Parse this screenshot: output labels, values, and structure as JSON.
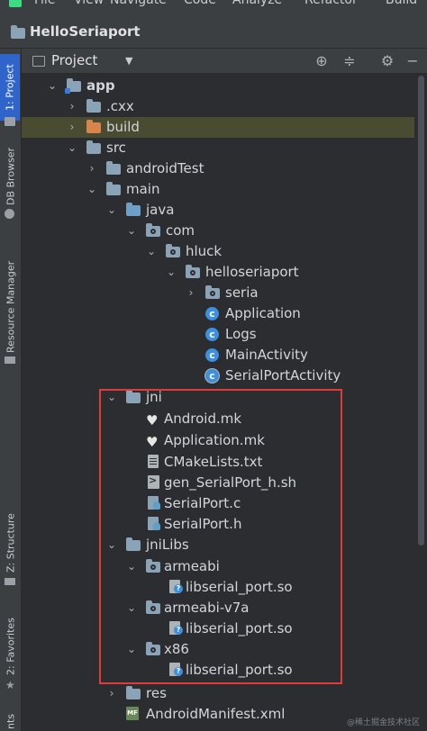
{
  "menu": {
    "items": [
      "File",
      "View",
      "Navigate",
      "Code",
      "Analyze",
      "Refactor",
      "Build"
    ]
  },
  "titlebar": {
    "project_name": "HelloSeriaport"
  },
  "left_strip": {
    "project_tab": "1: Project",
    "db_browser_tab": "DB Browser",
    "resource_manager_tab": "Resource Manager",
    "structure_tab": "Z: Structure",
    "favorites_tab": "2: Favorites",
    "variants_tab": "nts"
  },
  "panel_header": {
    "title": "Project",
    "icons": [
      "locate-icon",
      "collapse-all-icon",
      "settings-icon",
      "hide-icon"
    ]
  },
  "tree": [
    {
      "label": "app",
      "icon": "module-folder",
      "expanded": true,
      "bold": true
    },
    {
      "label": ".cxx",
      "icon": "folder",
      "expanded": false
    },
    {
      "label": "build",
      "icon": "excluded-folder",
      "expanded": false
    },
    {
      "label": "src",
      "icon": "folder",
      "expanded": true
    },
    {
      "label": "androidTest",
      "icon": "folder",
      "expanded": false
    },
    {
      "label": "main",
      "icon": "folder",
      "expanded": true
    },
    {
      "label": "java",
      "icon": "source-folder",
      "expanded": true
    },
    {
      "label": "com",
      "icon": "package",
      "expanded": true
    },
    {
      "label": "hluck",
      "icon": "package",
      "expanded": true
    },
    {
      "label": "helloseriaport",
      "icon": "package",
      "expanded": true
    },
    {
      "label": "seria",
      "icon": "package",
      "expanded": false
    },
    {
      "label": "Application",
      "icon": "class"
    },
    {
      "label": "Logs",
      "icon": "class"
    },
    {
      "label": "MainActivity",
      "icon": "class"
    },
    {
      "label": "SerialPortActivity",
      "icon": "class"
    },
    {
      "label": "jni",
      "icon": "folder",
      "expanded": true
    },
    {
      "label": "Android.mk",
      "icon": "mk-file"
    },
    {
      "label": "Application.mk",
      "icon": "mk-file"
    },
    {
      "label": "CMakeLists.txt",
      "icon": "text-file"
    },
    {
      "label": "gen_SerialPort_h.sh",
      "icon": "shell-file"
    },
    {
      "label": "SerialPort.c",
      "icon": "c-file"
    },
    {
      "label": "SerialPort.h",
      "icon": "c-file"
    },
    {
      "label": "jniLibs",
      "icon": "folder",
      "expanded": true
    },
    {
      "label": "armeabi",
      "icon": "package",
      "expanded": true
    },
    {
      "label": "libserial_port.so",
      "icon": "so-file"
    },
    {
      "label": "armeabi-v7a",
      "icon": "package",
      "expanded": true
    },
    {
      "label": "libserial_port.so",
      "icon": "so-file"
    },
    {
      "label": "x86",
      "icon": "package",
      "expanded": true
    },
    {
      "label": "libserial_port.so",
      "icon": "so-file"
    },
    {
      "label": "res",
      "icon": "resource-folder",
      "expanded": false
    },
    {
      "label": "AndroidManifest.xml",
      "icon": "manifest-file"
    }
  ],
  "watermark": "@稀土掘金技术社区"
}
